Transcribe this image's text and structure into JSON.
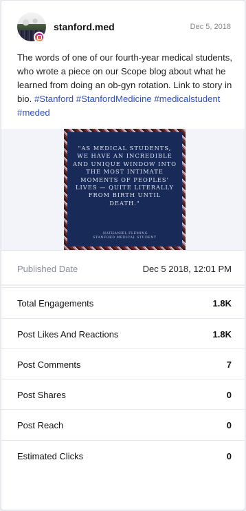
{
  "post": {
    "username": "stanford.med",
    "date": "Dec 5, 2018",
    "caption_text": "The words of one of our fourth-year medical students, who wrote a piece on our Scope blog about what he learned from doing an ob-gyn rotation. Link to story in bio.",
    "caption_tags": "#Stanford #StanfordMedicine #medicalstudent #meded",
    "platform_icon": "instagram-icon",
    "image": {
      "quote": "\"AS MEDICAL STUDENTS, WE HAVE AN INCREDIBLE AND UNIQUE WINDOW INTO THE MOST INTIMATE MOMENTS OF PEOPLES' LIVES — QUITE LITERALLY FROM BIRTH UNTIL DEATH.\"",
      "attribution_name": "-NATHANIEL FLEMING",
      "attribution_role": "STANFORD MEDICAL STUDENT"
    }
  },
  "published": {
    "label": "Published Date",
    "value": "Dec 5 2018, 12:01 PM"
  },
  "metrics": [
    {
      "label": "Total Engagements",
      "value": "1.8K"
    },
    {
      "label": "Post Likes And Reactions",
      "value": "1.8K"
    },
    {
      "label": "Post Comments",
      "value": "7"
    },
    {
      "label": "Post Shares",
      "value": "0"
    },
    {
      "label": "Post Reach",
      "value": "0"
    },
    {
      "label": "Estimated Clicks",
      "value": "0"
    }
  ],
  "colors": {
    "hashtag": "#2a4fd8",
    "quote_background": "#182a58"
  }
}
